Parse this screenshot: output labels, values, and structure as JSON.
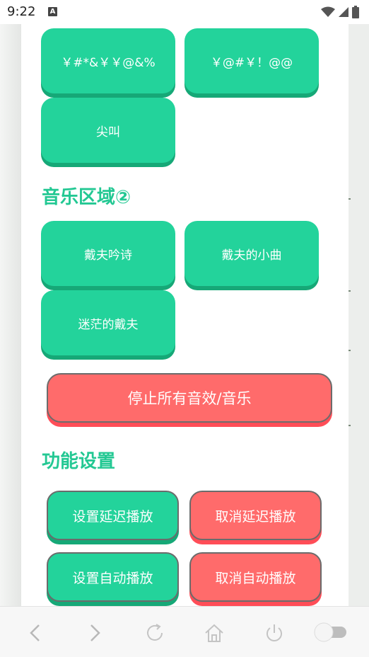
{
  "status_bar": {
    "time": "9:22",
    "notification_letter": "A"
  },
  "sound_buttons": [
    "￥#*&￥￥@&%",
    "￥@#￥！@@",
    "尖叫"
  ],
  "music_section": {
    "title": "音乐区域②",
    "buttons": [
      "戴夫吟诗",
      "戴夫的小曲",
      "迷茫的戴夫"
    ]
  },
  "stop_button": "停止所有音效/音乐",
  "settings_section": {
    "title": "功能设置",
    "set_delay": "设置延迟播放",
    "cancel_delay": "取消延迟播放",
    "set_auto": "设置自动播放",
    "cancel_auto": "取消自动播放"
  },
  "colors": {
    "accent_green": "#23d39b",
    "accent_red": "#ff6b6b"
  }
}
